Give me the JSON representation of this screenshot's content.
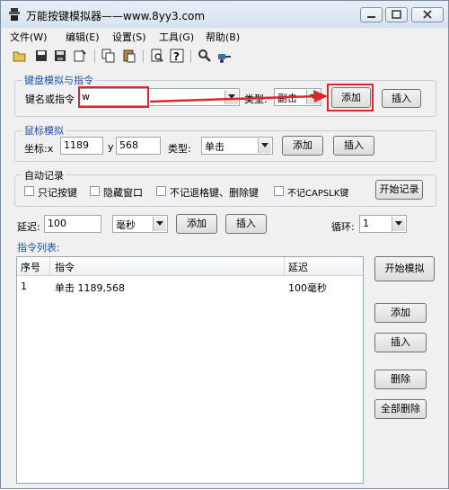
{
  "window": {
    "title": "万能按键模拟器——www.8yy3.com"
  },
  "menu": [
    "文件(W)",
    "编辑(E)",
    "设置(S)",
    "工具(G)",
    "帮助(B)"
  ],
  "toolbar_icons": [
    "open-folder-icon",
    "save-icon",
    "save-as-icon",
    "properties-icon",
    "copy-icon",
    "paste-icon",
    "print-preview-icon",
    "help-icon",
    "search-icon",
    "tool-icon"
  ],
  "keyboard": {
    "group_label": "键盘模拟与指令",
    "key_label": "键名或指令",
    "key_value": "w",
    "type_label": "类型:",
    "type_value": "副击",
    "add_label": "添加",
    "insert_label": "插入"
  },
  "mouse": {
    "group_label": "鼠标模拟",
    "coord_label": "坐标:x",
    "x_value": "1189",
    "y_label": "y",
    "y_value": "568",
    "type_label": "类型:",
    "type_value": "单击",
    "add_label": "添加",
    "insert_label": "插入"
  },
  "auto_record": {
    "group_label": "自动记录",
    "options": [
      "只记按键",
      "隐藏窗口",
      "不记退格键、删除键",
      "不记CAPSLK键"
    ],
    "start_label": "开始记录"
  },
  "delay_row": {
    "delay_label": "延迟:",
    "delay_value": "100",
    "unit_value": "毫秒",
    "add_label": "添加",
    "insert_label": "插入",
    "loop_label": "循环:",
    "loop_value": "1"
  },
  "command_list": {
    "label": "指令列表:",
    "columns": [
      "序号",
      "指令",
      "延迟"
    ],
    "rows": [
      {
        "index": "1",
        "command": "单击 1189,568",
        "delay": "100毫秒"
      }
    ]
  },
  "side_buttons": {
    "start_sim": "开始模拟",
    "add": "添加",
    "insert": "插入",
    "delete": "删除",
    "delete_all": "全部删除"
  },
  "colors": {
    "annotation_red": "#e0252a",
    "group_title_blue": "#1f4f9e"
  }
}
